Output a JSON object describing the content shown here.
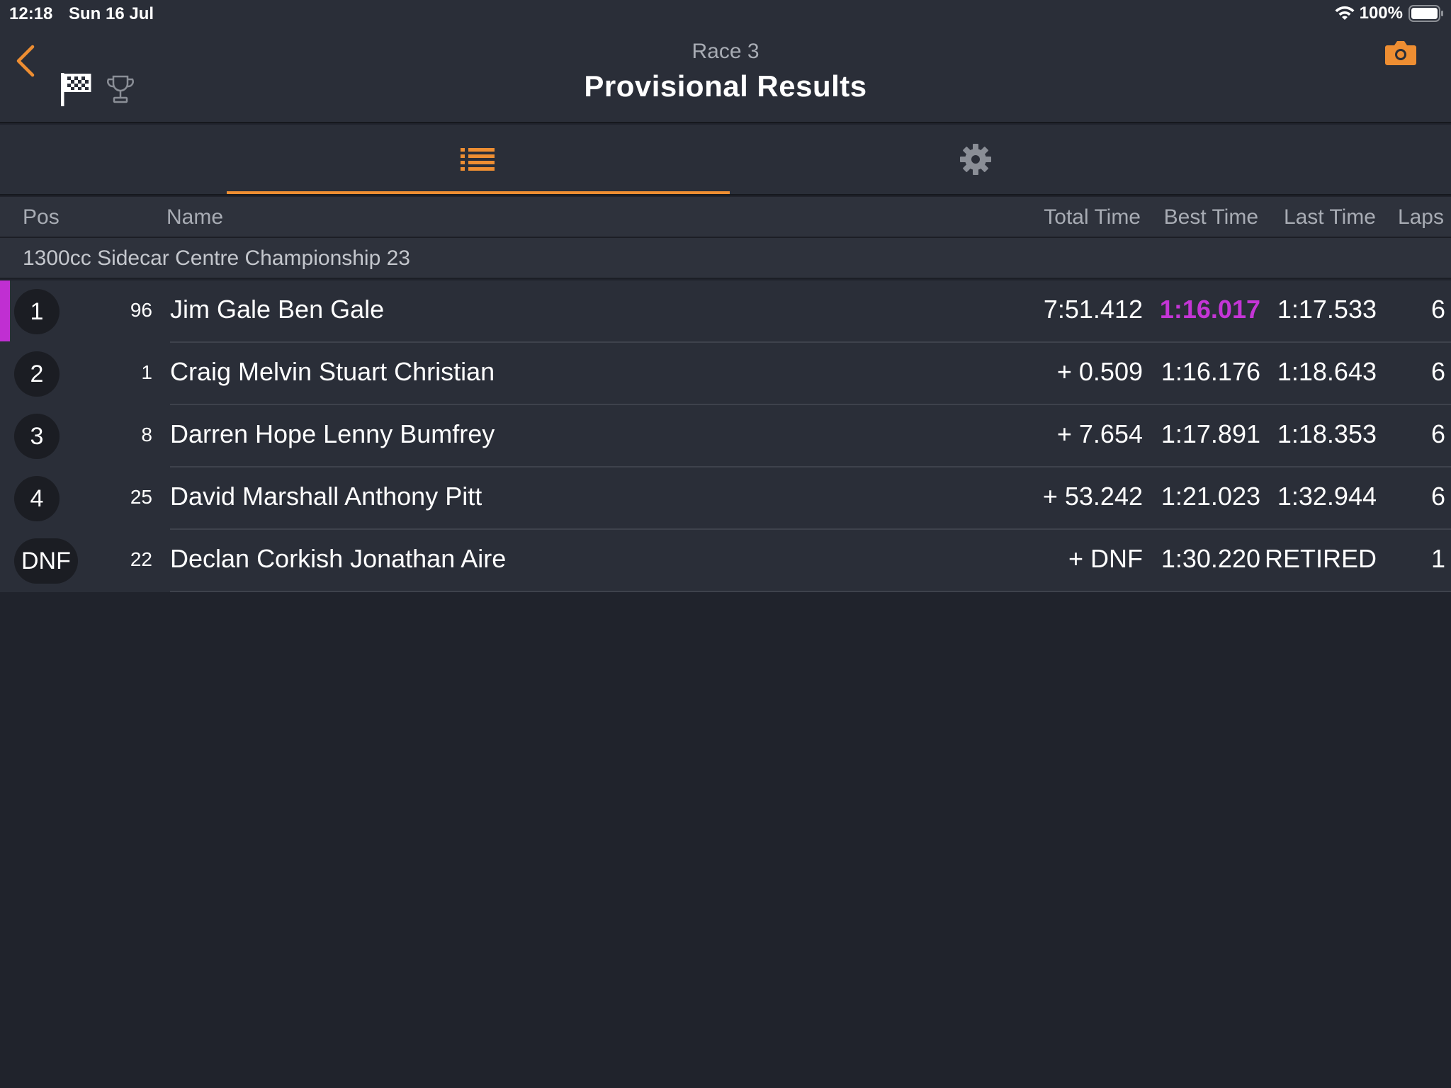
{
  "status_bar": {
    "time": "12:18",
    "date": "Sun 16 Jul",
    "battery_percent": "100%",
    "icons": [
      "wifi-icon",
      "battery-icon"
    ]
  },
  "header": {
    "subtitle": "Race 3",
    "title": "Provisional Results",
    "icons": [
      "back-icon",
      "checkered-flag-icon",
      "trophy-icon",
      "camera-icon"
    ]
  },
  "tabs": [
    {
      "icon": "list-icon",
      "active": true
    },
    {
      "icon": "gear-icon",
      "active": false
    }
  ],
  "columns": {
    "pos": "Pos",
    "name": "Name",
    "total": "Total Time",
    "best": "Best Time",
    "last": "Last Time",
    "laps": "Laps"
  },
  "group": {
    "title": "1300cc Sidecar Centre Championship 23"
  },
  "rows": [
    {
      "pos": "1",
      "num": "96",
      "name": "Jim Gale Ben Gale",
      "total": "7:51.412",
      "best": "1:16.017",
      "last": "1:17.533",
      "laps": "6"
    },
    {
      "pos": "2",
      "num": "1",
      "name": "Craig Melvin Stuart Christian",
      "total": "+ 0.509",
      "best": "1:16.176",
      "last": "1:18.643",
      "laps": "6"
    },
    {
      "pos": "3",
      "num": "8",
      "name": "Darren Hope Lenny Bumfrey",
      "total": "+ 7.654",
      "best": "1:17.891",
      "last": "1:18.353",
      "laps": "6"
    },
    {
      "pos": "4",
      "num": "25",
      "name": "David Marshall Anthony Pitt",
      "total": "+ 53.242",
      "best": "1:21.023",
      "last": "1:32.944",
      "laps": "6"
    },
    {
      "pos": "DNF",
      "num": "22",
      "name": "Declan Corkish Jonathan Aire",
      "total": "+ DNF",
      "best": "1:30.220",
      "last": "RETIRED",
      "laps": "1"
    }
  ],
  "colors": {
    "accent": "#ee8e32",
    "fastest_lap": "#c435d6",
    "background": "#20232c",
    "bar": "#2a2e38"
  }
}
